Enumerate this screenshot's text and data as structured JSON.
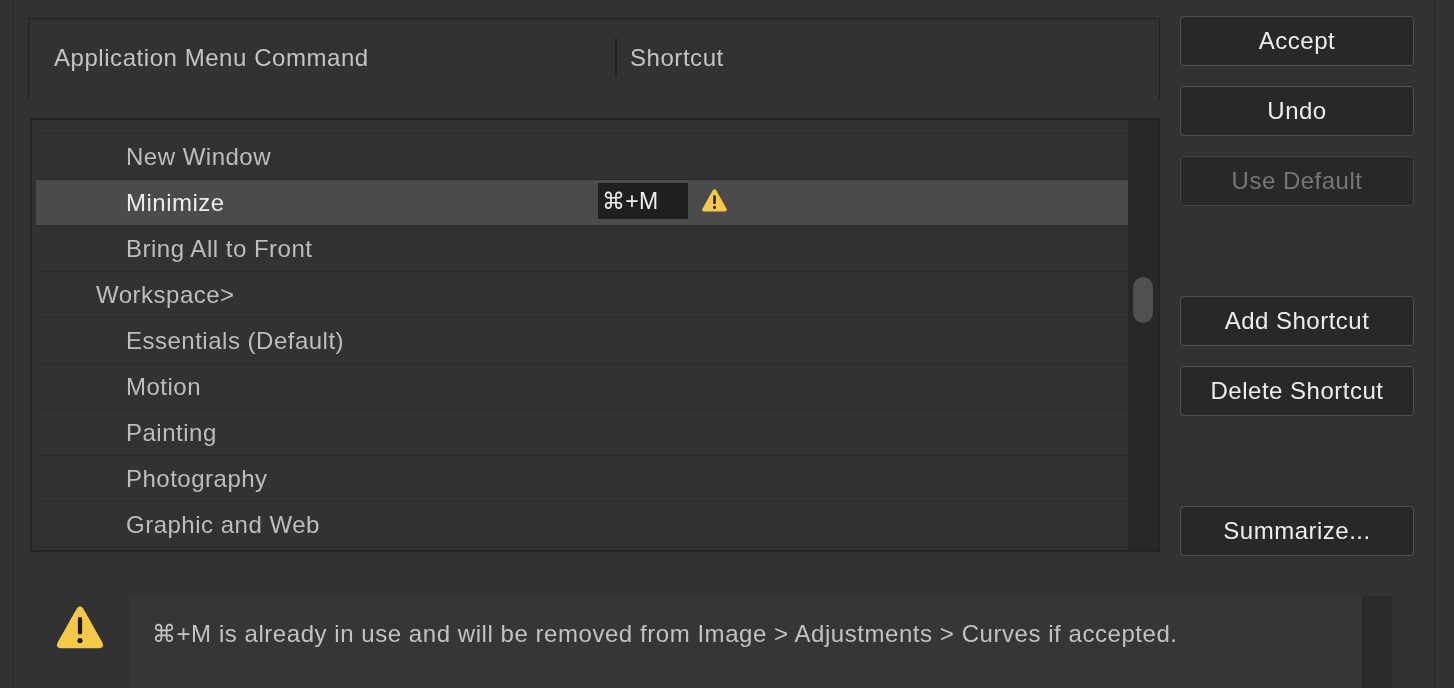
{
  "table": {
    "columns": [
      "Application Menu Command",
      "Shortcut"
    ],
    "tree": [
      {
        "children": [
          {
            "label": "New Window",
            "selected": false,
            "conflict": false
          },
          {
            "label": "Minimize",
            "selected": true,
            "shortcut": "⌘+M",
            "conflict": true
          },
          {
            "label": "Bring All to Front",
            "selected": false,
            "conflict": false
          }
        ]
      },
      {
        "label": "Workspace>",
        "selected": false,
        "conflict": false,
        "children": [
          {
            "label": "Essentials (Default)",
            "selected": false,
            "conflict": false
          },
          {
            "label": "Motion",
            "selected": false,
            "conflict": false
          },
          {
            "label": "Painting",
            "selected": false,
            "conflict": false
          },
          {
            "label": "Photography",
            "selected": false,
            "conflict": false
          },
          {
            "label": "Graphic and Web",
            "selected": false,
            "conflict": false
          }
        ]
      }
    ]
  },
  "button_groups": [
    {
      "buttons": [
        {
          "label": "Accept",
          "disabled": false
        },
        {
          "label": "Undo",
          "disabled": false
        },
        {
          "label": "Use Default",
          "disabled": true
        }
      ]
    },
    {
      "buttons": [
        {
          "label": "Add Shortcut",
          "disabled": false
        },
        {
          "label": "Delete Shortcut",
          "disabled": false
        }
      ]
    },
    {
      "buttons": [
        {
          "label": "Summarize...",
          "disabled": false
        }
      ]
    }
  ],
  "message": {
    "kind": "warning",
    "text": "⌘+M is already in use and will be removed from Image > Adjustments > Curves if accepted."
  }
}
